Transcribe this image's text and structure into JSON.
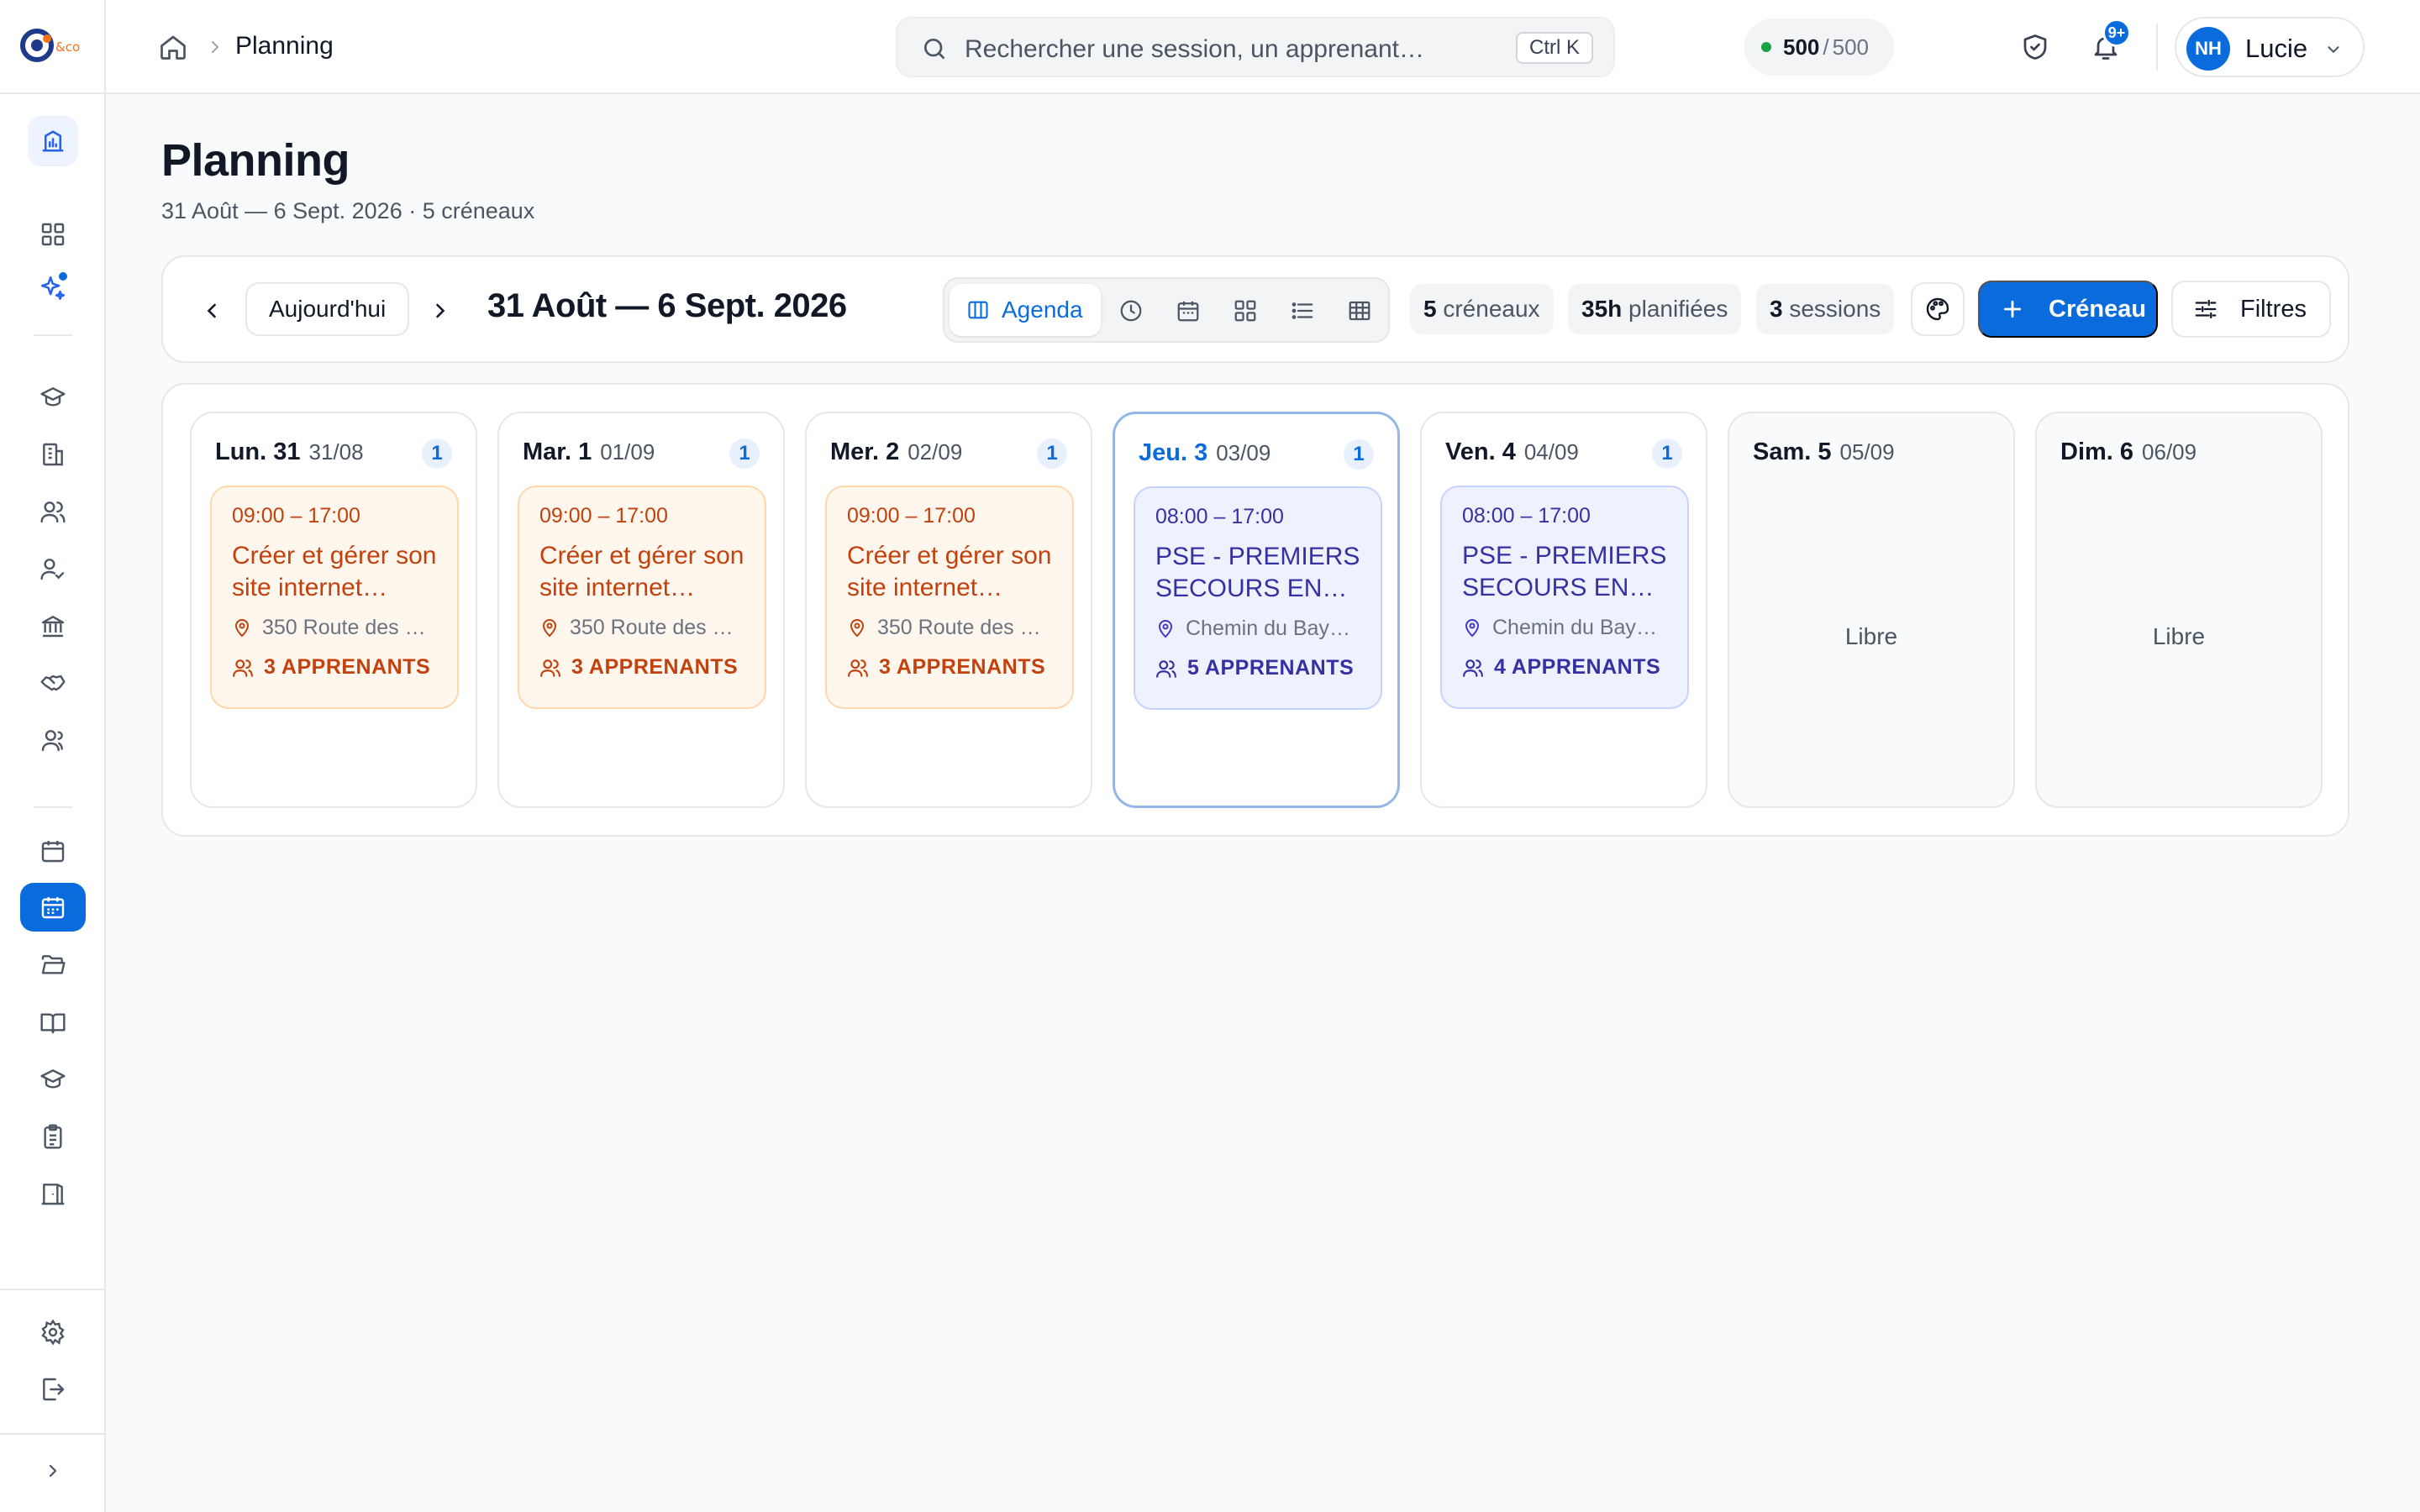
{
  "app": {
    "logo_text": "&co"
  },
  "header": {
    "breadcrumb_current": "Planning",
    "search_placeholder": "Rechercher une session, un apprenant…",
    "search_shortcut": "Ctrl K",
    "credits_used": "500",
    "credits_sep": "/",
    "credits_total": "500",
    "notifications_badge": "9+",
    "user_initials": "NH",
    "user_name": "Lucie"
  },
  "page": {
    "title": "Planning",
    "subtitle": "31 Août — 6 Sept. 2026 · 5 créneaux"
  },
  "toolbar": {
    "today_label": "Aujourd'hui",
    "range_title": "31 Août — 6 Sept. 2026",
    "view_agenda_label": "Agenda",
    "stats": [
      {
        "value": "5",
        "label": "créneaux"
      },
      {
        "value": "35h",
        "label": "planifiées"
      },
      {
        "value": "3",
        "label": "sessions"
      }
    ],
    "add_label": "Créneau",
    "filters_label": "Filtres"
  },
  "colors": {
    "accent": "#0a6cdc",
    "orange_event": "#c2410c",
    "indigo_event": "#3730a3"
  },
  "week": {
    "free_label": "Libre",
    "days": [
      {
        "name": "Lun. 31",
        "date": "31/08",
        "count": "1",
        "event": {
          "time": "09:00 – 17:00",
          "title": "Créer et gérer son site internet…",
          "location": "350 Route des M…",
          "learners": "3 APPRENANTS"
        }
      },
      {
        "name": "Mar. 1",
        "date": "01/09",
        "count": "1",
        "event": {
          "time": "09:00 – 17:00",
          "title": "Créer et gérer son site internet…",
          "location": "350 Route des M…",
          "learners": "3 APPRENANTS"
        }
      },
      {
        "name": "Mer. 2",
        "date": "02/09",
        "count": "1",
        "event": {
          "time": "09:00 – 17:00",
          "title": "Créer et gérer son site internet…",
          "location": "350 Route des M…",
          "learners": "3 APPRENANTS"
        }
      },
      {
        "name": "Jeu. 3",
        "date": "03/09",
        "count": "1",
        "event": {
          "time": "08:00 – 17:00",
          "title": "PSE - PREMIERS SECOURS EN…",
          "location": "Chemin du Bayo…",
          "learners": "5 APPRENANTS"
        }
      },
      {
        "name": "Ven. 4",
        "date": "04/09",
        "count": "1",
        "event": {
          "time": "08:00 – 17:00",
          "title": "PSE - PREMIERS SECOURS EN…",
          "location": "Chemin du Bayo…",
          "learners": "4 APPRENANTS"
        }
      },
      {
        "name": "Sam. 5",
        "date": "05/09"
      },
      {
        "name": "Dim. 6",
        "date": "06/09"
      }
    ]
  }
}
